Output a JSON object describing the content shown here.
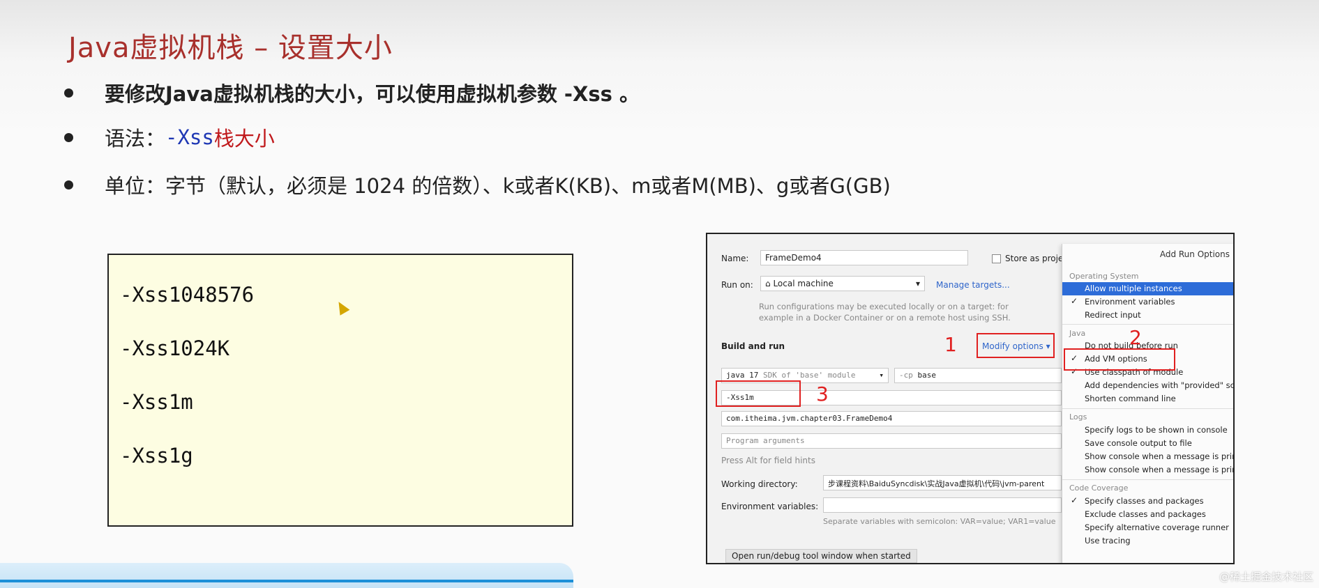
{
  "slide": {
    "title": "Java虚拟机栈 – 设置大小",
    "bullet1": "要修改Java虚拟机栈的大小，可以使用虚拟机参数 -Xss 。",
    "bullet2_label": "语法：",
    "bullet2_flag": "-Xss",
    "bullet2_rest": "栈大小",
    "bullet3": "单位：字节（默认，必须是 1024 的倍数）、k或者K(KB)、m或者M(MB)、g或者G(GB)"
  },
  "code_examples": [
    "-Xss1048576",
    "-Xss1024K",
    "-Xss1m",
    "-Xss1g"
  ],
  "ide": {
    "name_label": "Name:",
    "name_value": "FrameDemo4",
    "store_label": "Store as proje",
    "run_on_label": "Run on:",
    "run_on_value": "Local machine",
    "manage_targets": "Manage targets...",
    "run_hint": "Run configurations may be executed locally or on a target: for example in a Docker Container or on a remote host using SSH.",
    "build_and_run": "Build and run",
    "modify_options": "Modify options",
    "jdk_value": "java 17",
    "jdk_hint": "SDK of 'base' module",
    "cp_label": "-cp",
    "cp_value": "base",
    "vm_options_value": "-Xss1m",
    "main_class_value": "com.itheima.jvm.chapter03.FrameDemo4",
    "program_args_placeholder": "Program arguments",
    "field_hints": "Press Alt for field hints",
    "working_dir_label": "Working directory:",
    "working_dir_value": "步课程资料\\BaiduSyncdisk\\实战Java虚拟机\\代码\\jvm-parent",
    "env_label": "Environment variables:",
    "env_hint": "Separate variables with semicolon: VAR=value; VAR1=value",
    "open_tool_window": "Open run/debug tool window when started",
    "annotations": [
      "1",
      "2",
      "3"
    ]
  },
  "menu": {
    "title": "Add Run Options",
    "sections": {
      "os": "Operating System",
      "java": "Java",
      "logs": "Logs",
      "coverage": "Code Coverage"
    },
    "os_items": [
      "Allow multiple instances",
      "Environment variables",
      "Redirect input"
    ],
    "java_items": [
      "Do not build before run",
      "Add VM options",
      "Use classpath of module",
      "Add dependencies with \"provided\" sc",
      "Shorten command line"
    ],
    "logs_items": [
      "Specify logs to be shown in console",
      "Save console output to file",
      "Show console when a message is prin",
      "Show console when a message is prin"
    ],
    "coverage_items": [
      "Specify classes and packages",
      "Exclude classes and packages",
      "Specify alternative coverage runner",
      "Use tracing"
    ]
  },
  "watermark": "@稀土掘金技术社区",
  "colors": {
    "title": "#a8302c",
    "flag_blue": "#1f38b4",
    "flag_red": "#c0191c",
    "highlight": "#2d6cd8",
    "annotation_red": "#e02020"
  }
}
